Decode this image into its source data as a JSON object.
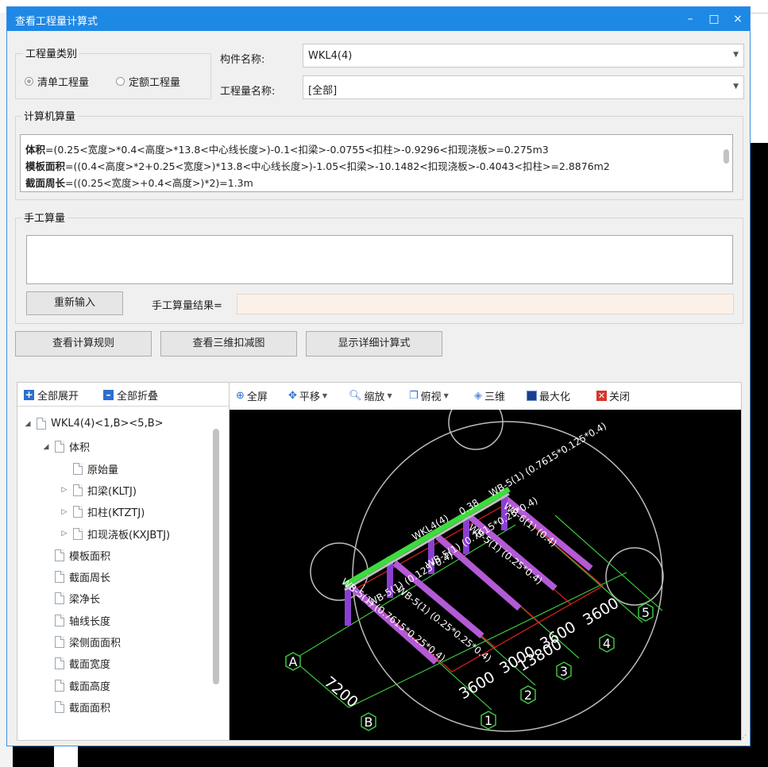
{
  "dialog": {
    "title": "查看工程量计算式",
    "minimize": "–",
    "maximize": "□",
    "close": "×"
  },
  "category": {
    "group_title": "工程量类别",
    "option1": "清单工程量",
    "option2": "定额工程量",
    "selected": "option1"
  },
  "component": {
    "label": "构件名称:",
    "value": "WKL4(4)"
  },
  "quantity": {
    "label": "工程量名称:",
    "value": "[全部]"
  },
  "computer": {
    "group_title": "计算机算量",
    "line1_name": "体积",
    "line1_expr": "=(0.25<宽度>*0.4<高度>*13.8<中心线长度>)-0.1<扣梁>-0.0755<扣柱>-0.9296<扣现浇板>=0.275m3",
    "line2_name": "模板面积",
    "line2_expr": "=((0.4<高度>*2+0.25<宽度>)*13.8<中心线长度>)-1.05<扣梁>-10.1482<扣现浇板>-0.4043<扣柱>=2.8876m2",
    "line3_name": "截面周长",
    "line3_expr": "=((0.25<宽度>+0.4<高度>)*2)=1.3m"
  },
  "manual": {
    "group_title": "手工算量",
    "reinput_button": "重新输入",
    "result_label": "手工算量结果="
  },
  "actions": {
    "view_rules": "查看计算规则",
    "view_3d": "查看三维扣减图",
    "show_detail": "显示详细计算式"
  },
  "tree_toolbar": {
    "expand_all": "全部展开",
    "collapse_all": "全部折叠"
  },
  "tree": [
    {
      "label": "WKL4(4)<1,B><5,B>",
      "toggle": "◢",
      "level": 0
    },
    {
      "label": "体积",
      "toggle": "◢",
      "level": 1
    },
    {
      "label": "原始量",
      "toggle": "",
      "level": 2
    },
    {
      "label": "扣梁(KLTJ)",
      "toggle": "▷",
      "level": 2
    },
    {
      "label": "扣柱(KTZTJ)",
      "toggle": "▷",
      "level": 2
    },
    {
      "label": "扣现浇板(KXJBTJ)",
      "toggle": "▷",
      "level": 2
    },
    {
      "label": "模板面积",
      "toggle": "",
      "level": 1
    },
    {
      "label": "截面周长",
      "toggle": "",
      "level": 1
    },
    {
      "label": "梁净长",
      "toggle": "",
      "level": 1
    },
    {
      "label": "轴线长度",
      "toggle": "",
      "level": 1
    },
    {
      "label": "梁侧面面积",
      "toggle": "",
      "level": 1
    },
    {
      "label": "截面宽度",
      "toggle": "",
      "level": 1
    },
    {
      "label": "截面高度",
      "toggle": "",
      "level": 1
    },
    {
      "label": "截面面积",
      "toggle": "",
      "level": 1
    }
  ],
  "viewer_toolbar": {
    "fullscreen": "全屏",
    "pan": "平移",
    "zoom": "缩放",
    "top_view": "俯视",
    "three_d": "三维",
    "maximize": "最大化",
    "close": "关闭"
  },
  "cad": {
    "axis_labels": [
      "A",
      "B",
      "1",
      "2",
      "3",
      "4",
      "5"
    ],
    "dims": [
      "7200",
      "3600",
      "3000",
      "3600",
      "3600",
      "13800"
    ],
    "beam_labels": [
      "WKL4(4)",
      "WB-5(1) (0.7615*0.125*0.4)",
      "WB-6(1) (0.4)",
      "WB-5(1) (0.25*0.4)",
      "WB-5(1) (0.125*0.4)",
      "WB-5(1) (0.7615*0.25*0.4)",
      "WB-5(1) (0.25*0.25*0.4)",
      "WB-5(1) (0.7615*0.25*0.4)",
      "0.38"
    ],
    "colors": {
      "grid_green": "#3ec43e",
      "slab_red": "#e02020",
      "beam_purple": "#b35ad6",
      "column_purple": "#8a3fd0",
      "highlight_green": "#3ddc3d",
      "text_white": "#ffffff"
    }
  }
}
